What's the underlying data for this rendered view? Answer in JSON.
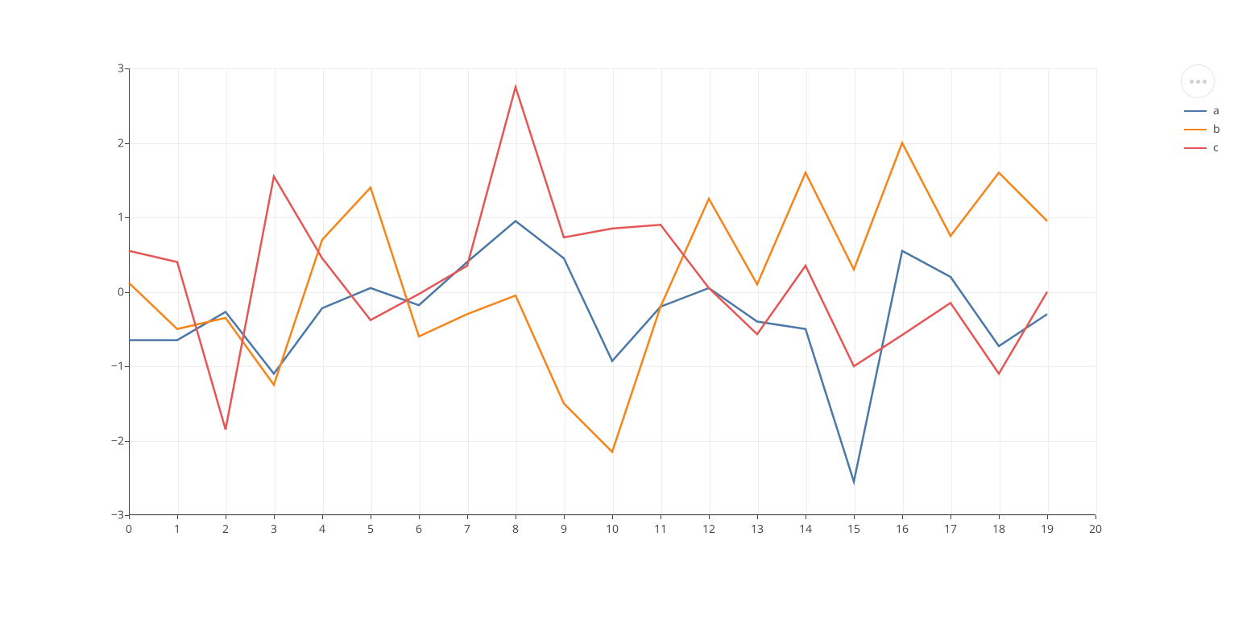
{
  "chart_data": {
    "type": "line",
    "x": [
      0,
      1,
      2,
      3,
      4,
      5,
      6,
      7,
      8,
      9,
      10,
      11,
      12,
      13,
      14,
      15,
      16,
      17,
      18,
      19
    ],
    "series": [
      {
        "name": "a",
        "color": "#4c78a8",
        "values": [
          -0.65,
          -0.65,
          -0.27,
          -1.1,
          -0.22,
          0.05,
          -0.18,
          0.4,
          0.95,
          0.45,
          -0.93,
          -0.2,
          0.05,
          -0.4,
          -0.5,
          -2.55,
          0.55,
          0.2,
          -0.73,
          -0.3
        ]
      },
      {
        "name": "b",
        "color": "#f58518",
        "values": [
          0.12,
          -0.5,
          -0.35,
          -1.25,
          0.7,
          1.4,
          -0.6,
          -0.3,
          -0.05,
          -1.5,
          -2.15,
          -0.2,
          1.25,
          0.1,
          1.6,
          0.3,
          2.0,
          0.75,
          1.6,
          0.95
        ]
      },
      {
        "name": "c",
        "color": "#e45756",
        "values": [
          0.55,
          0.4,
          -1.85,
          1.55,
          0.45,
          -0.38,
          -0.03,
          0.35,
          2.75,
          0.73,
          0.85,
          0.9,
          0.05,
          -0.57,
          0.35,
          -1.0,
          -0.58,
          -0.15,
          -1.1,
          0.0
        ]
      }
    ],
    "xlim": [
      0,
      20
    ],
    "ylim": [
      -3,
      3
    ],
    "xticks": [
      0,
      1,
      2,
      3,
      4,
      5,
      6,
      7,
      8,
      9,
      10,
      11,
      12,
      13,
      14,
      15,
      16,
      17,
      18,
      19,
      20
    ],
    "yticks": [
      -3,
      -2,
      -1,
      0,
      1,
      2,
      3
    ],
    "xlabel": "",
    "ylabel": "",
    "title": ""
  },
  "legend": {
    "items": [
      "a",
      "b",
      "c"
    ]
  },
  "options_button": {
    "aria_label": "More options"
  },
  "ytick_labels": {
    "n3": "−3",
    "n2": "−2",
    "n1": "−1",
    "0": "0",
    "1": "1",
    "2": "2",
    "3": "3"
  }
}
